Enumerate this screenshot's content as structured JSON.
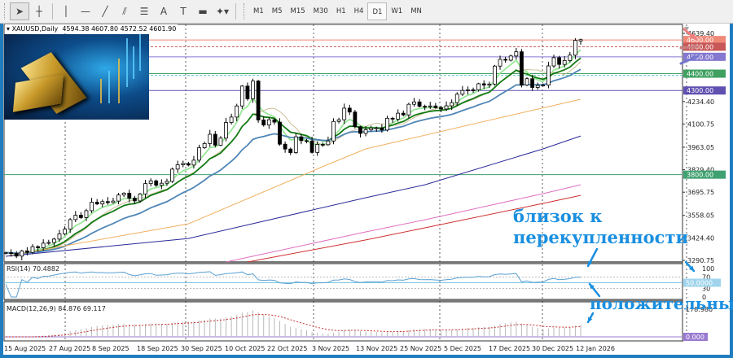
{
  "toolbar": {
    "tools": [
      {
        "name": "cursor",
        "icon": "cursor-arrow-icon",
        "glyph": "➤",
        "active": true
      },
      {
        "name": "crosshair",
        "icon": "crosshair-icon",
        "glyph": "┼"
      },
      {
        "name": "vertical-line",
        "icon": "vertical-line-icon",
        "glyph": "│"
      },
      {
        "name": "horizontal-line",
        "icon": "horizontal-line-icon",
        "glyph": "—"
      },
      {
        "name": "trendline",
        "icon": "trendline-icon",
        "glyph": "╱"
      },
      {
        "name": "equidistant-channel",
        "icon": "channel-icon",
        "glyph": "⫽"
      },
      {
        "name": "fibonacci",
        "icon": "fibonacci-icon",
        "glyph": "☰"
      },
      {
        "name": "text",
        "icon": "text-icon",
        "glyph": "A"
      },
      {
        "name": "text-label",
        "icon": "text-label-icon",
        "glyph": "T"
      },
      {
        "name": "rectangle",
        "icon": "rectangle-icon",
        "glyph": "▬"
      },
      {
        "name": "shapes-dropdown",
        "icon": "shapes-dropdown-icon",
        "glyph": "✦▾"
      }
    ],
    "timeframes": [
      "M1",
      "M5",
      "M15",
      "M30",
      "H1",
      "H4",
      "D1",
      "W1",
      "MN"
    ],
    "active_timeframe": "D1"
  },
  "chart_header": {
    "symbol": "XAUUSD,Daily",
    "ohlc": "4594.38 4607.80 4572.52 4601.90"
  },
  "chart_data": [
    {
      "type": "candlestick",
      "title": "XAUUSD,Daily",
      "start_date": "2025-08-15",
      "closes": [
        3336,
        3332,
        3316,
        3347,
        3338,
        3372,
        3366,
        3393,
        3397,
        3417,
        3448,
        3476,
        3533,
        3559,
        3545,
        3586,
        3636,
        3626,
        3640,
        3634,
        3643,
        3679,
        3690,
        3660,
        3644,
        3685,
        3747,
        3763,
        3737,
        3749,
        3760,
        3833,
        3859,
        3866,
        3857,
        3886,
        3960,
        3985,
        4040,
        3975,
        4017,
        4110,
        4142,
        4208,
        4326,
        4251,
        4356,
        4125,
        4095,
        4126,
        4112,
        3981,
        3952,
        3931,
        4025,
        4002,
        4000,
        3932,
        3980,
        3978,
        4000,
        4116,
        4126,
        4195,
        4172,
        4085,
        4045,
        4067,
        4077,
        4078,
        4065,
        4135,
        4130,
        4165,
        4155,
        4218,
        4232,
        4206,
        4203,
        4208,
        4198,
        4190,
        4209,
        4228,
        4278,
        4300,
        4304,
        4303,
        4340,
        4332,
        4338,
        4445,
        4485,
        4480,
        4505,
        4530,
        4332,
        4370,
        4318,
        4330,
        4332,
        4446,
        4495,
        4455,
        4478,
        4510,
        4598,
        4601.9
      ],
      "last_bar": {
        "open": 4594.38,
        "high": 4607.8,
        "low": 4572.52,
        "close": 4601.9
      },
      "ylim": [
        3290.75,
        4639.4
      ],
      "y_ticks": [
        "4639.40",
        "4234.40",
        "4100.75",
        "3963.05",
        "3829.40",
        "3695.75",
        "3558.05",
        "3424.40",
        "3290.75"
      ],
      "x_ticks": [
        "15 Aug 2025",
        "27 Aug 2025",
        "8 Sep 2025",
        "18 Sep 2025",
        "30 Sep 2025",
        "10 Oct 2025",
        "22 Oct 2025",
        "3 Nov 2025",
        "13 Nov 2025",
        "25 Nov 2025",
        "5 Dec 2025",
        "17 Dec 2025",
        "30 Dec 2025",
        "12 Jan 2026"
      ],
      "moving_averages": [
        {
          "kind": "ema",
          "period": 5,
          "color": "#98e898"
        },
        {
          "kind": "sma",
          "period": 9,
          "color": "#cbbd96"
        },
        {
          "kind": "ema",
          "period": 10,
          "color": "#137a13"
        },
        {
          "kind": "ema",
          "period": 21,
          "color": "#4f86b6"
        },
        {
          "kind": "line",
          "color": "#f0b060",
          "points": [
            [
              "2025-08-15",
              3315
            ],
            [
              "2025-10-02",
              3508
            ],
            [
              "2025-11-07",
              3861
            ],
            [
              "2025-11-18",
              3953
            ],
            [
              "2025-12-30",
              4175
            ],
            [
              "2026-01-13",
              4248
            ]
          ]
        },
        {
          "kind": "line",
          "color": "#2a2a9a",
          "points": [
            [
              "2025-08-15",
              3315
            ],
            [
              "2025-10-02",
              3421
            ],
            [
              "2025-11-18",
              3663
            ],
            [
              "2025-12-03",
              3740
            ],
            [
              "2026-01-02",
              3953
            ],
            [
              "2026-01-13",
              4030
            ]
          ]
        },
        {
          "kind": "line",
          "color": "#e070c0",
          "points": [
            [
              "2025-10-13",
              3281
            ],
            [
              "2025-11-18",
              3460
            ],
            [
              "2025-12-03",
              3532
            ],
            [
              "2026-01-02",
              3687
            ],
            [
              "2026-01-13",
              3740
            ]
          ]
        },
        {
          "kind": "line",
          "color": "#d03030",
          "points": [
            [
              "2025-10-17",
              3281
            ],
            [
              "2025-11-18",
              3412
            ],
            [
              "2025-12-03",
              3484
            ],
            [
              "2026-01-02",
              3629
            ],
            [
              "2026-01-13",
              3677
            ]
          ]
        }
      ],
      "hlines": [
        {
          "value": 4600,
          "label": "4600.00",
          "color": "#f08878",
          "style": "solid"
        },
        {
          "value": 4560,
          "label": "4560.00",
          "color": "#c85858",
          "style": "dashed"
        },
        {
          "value": 4500,
          "label": "4500.00",
          "color": "#8478d0",
          "style": "solid"
        },
        {
          "value": 4400,
          "label": "4400.00",
          "color": "#3fa060",
          "style": "solid"
        },
        {
          "value": 4390,
          "label": "",
          "color": "#60c8c0",
          "style": "dashed"
        },
        {
          "value": 4300,
          "label": "4300.00",
          "color": "#6050b0",
          "style": "solid"
        },
        {
          "value": 3800,
          "label": "3800.00",
          "color": "#3fa070",
          "style": "solid"
        }
      ],
      "grid": "vertical-dashed"
    },
    {
      "type": "line",
      "title": "RSI(14) 70.4882",
      "ylim": [
        0,
        100
      ],
      "y_ticks": [
        "100",
        "70",
        "30",
        "0"
      ],
      "levels": [
        70,
        50,
        30
      ],
      "level_label": "50.0000",
      "period": 14,
      "color": "#5aa0d0"
    },
    {
      "type": "bar",
      "title": "MACD(12,26,9) 84.876 69.117",
      "y_ticks": [
        "178.980"
      ],
      "zero_label": "0.000",
      "fast": 12,
      "slow": 26,
      "signal": 9,
      "hist_color": "#b8b8b8",
      "signal_color": "#c83030"
    }
  ],
  "annotations": {
    "overbought_line1": "близок к",
    "overbought_line2": "перекупленности",
    "positive": "положительны",
    "color": "#1a8fe0"
  }
}
